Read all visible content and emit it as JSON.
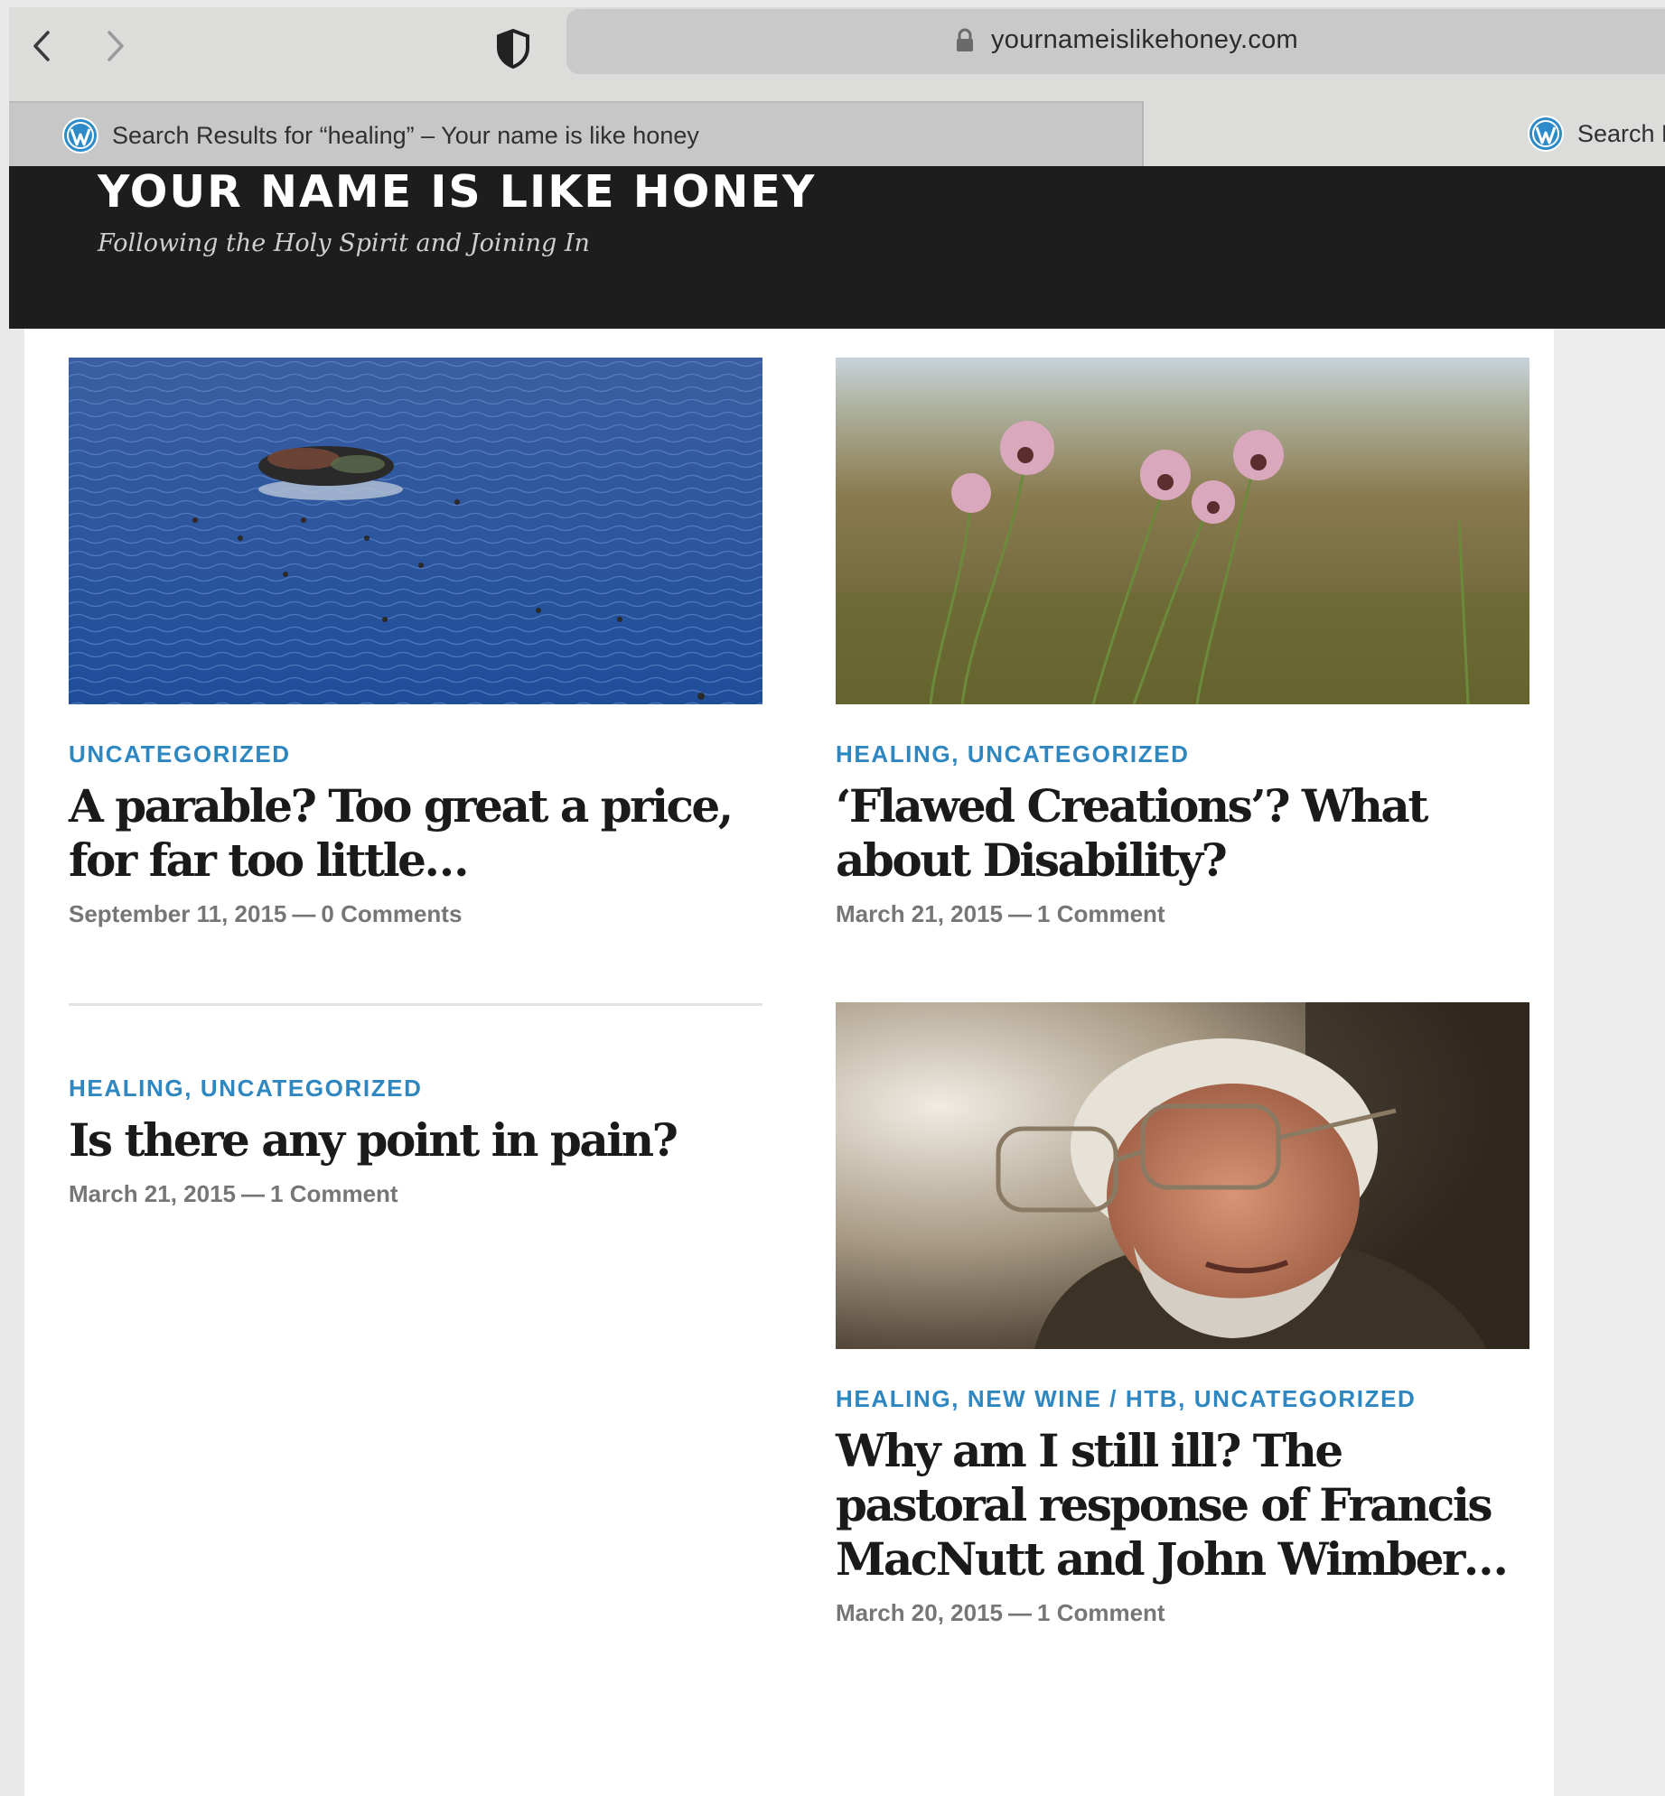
{
  "browser": {
    "url": "yournameislikehoney.com",
    "active_tab_title": "Search Results for “healing” – Your name is like honey",
    "other_tab_title": "Search R"
  },
  "site": {
    "title": "YOUR NAME IS LIKE HONEY",
    "tagline": "Following the Holy Spirit and Joining In"
  },
  "posts": [
    {
      "categories": "UNCATEGORIZED",
      "title": "A parable? Too great a price, for far too little…",
      "date": "September 11, 2015",
      "separator": "—",
      "comments": "0 Comments",
      "image": "refugee-boat-at-sea"
    },
    {
      "categories": "HEALING, UNCATEGORIZED",
      "title": "‘Flawed Creations’? What about Disability?",
      "date": "March 21, 2015",
      "separator": "—",
      "comments": "1 Comment",
      "image": "pink-wildflowers"
    },
    {
      "categories": "HEALING, UNCATEGORIZED",
      "title": "Is there any point in pain?",
      "date": "March 21, 2015",
      "separator": "—",
      "comments": "1 Comment",
      "image": ""
    },
    {
      "categories": "HEALING, NEW WINE / HTB, UNCATEGORIZED",
      "title": "Why am I still ill? The pastoral response of Francis MacNutt and John Wimber…",
      "date": "March 20, 2015",
      "separator": "—",
      "comments": "1 Comment",
      "image": "elderly-man-portrait"
    }
  ],
  "colors": {
    "category": "#2e87c0",
    "header_bg": "#1d1d1d",
    "title": "#1a1a1a",
    "meta": "#767676"
  }
}
